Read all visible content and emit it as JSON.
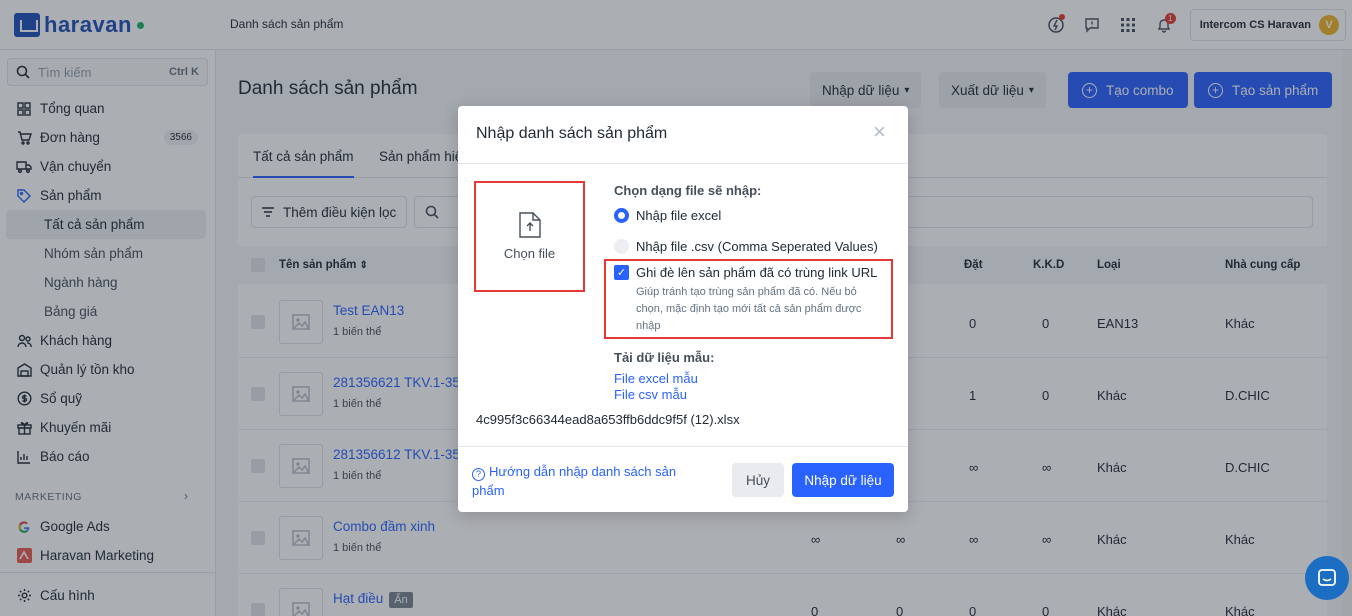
{
  "brand": {
    "name": "haravan"
  },
  "topbar": {
    "title": "Danh sách sản phẩm",
    "notification_count": "1",
    "account_name": "Intercom CS Haravan",
    "avatar_initial": "V"
  },
  "sidebar": {
    "search_placeholder": "Tìm kiếm",
    "search_shortcut": "Ctrl K",
    "items": [
      {
        "label": "Tổng quan",
        "icon": "grid-icon"
      },
      {
        "label": "Đơn hàng",
        "icon": "cart-icon",
        "count": "3566"
      },
      {
        "label": "Vận chuyển",
        "icon": "truck-icon"
      },
      {
        "label": "Sản phẩm",
        "icon": "tag-icon"
      }
    ],
    "sub_items": [
      {
        "label": "Tất cả sản phẩm",
        "active": true
      },
      {
        "label": "Nhóm sản phẩm"
      },
      {
        "label": "Ngành hàng"
      },
      {
        "label": "Bảng giá"
      }
    ],
    "items2": [
      {
        "label": "Khách hàng",
        "icon": "users-icon"
      },
      {
        "label": "Quản lý tồn kho",
        "icon": "inventory-icon"
      },
      {
        "label": "Sổ quỹ",
        "icon": "dollar-icon"
      },
      {
        "label": "Khuyến mãi",
        "icon": "gift-icon"
      },
      {
        "label": "Báo cáo",
        "icon": "chart-icon"
      }
    ],
    "marketing_label": "MARKETING",
    "marketing_items": [
      {
        "label": "Google Ads",
        "icon": "google-icon"
      },
      {
        "label": "Haravan Marketing",
        "icon": "haravan-marketing-icon"
      }
    ],
    "settings_label": "Cấu hình"
  },
  "main": {
    "title": "Danh sách sản phẩm",
    "import_label": "Nhập dữ liệu",
    "export_label": "Xuất dữ liệu",
    "create_combo_label": "Tạo combo",
    "create_product_label": "Tạo sản phẩm",
    "tabs": [
      "Tất cả sản phẩm",
      "Sản phẩm hiể"
    ],
    "filter_label": "Thêm điều kiện lọc",
    "columns": {
      "name": "Tên sản phẩm",
      "ordered": "Đặt",
      "kkd": "K.K.D",
      "type": "Loại",
      "supplier": "Nhà cung cấp"
    },
    "rows": [
      {
        "name": "Test EAN13",
        "variants": "1 biến thể",
        "c1": "",
        "c2": "",
        "ordered": "0",
        "kkd": "0",
        "type": "EAN13",
        "supplier": "Khác"
      },
      {
        "name": "281356621 TKV.1-350",
        "variants": "1 biến thể",
        "c1": "",
        "c2": "",
        "ordered": "1",
        "kkd": "0",
        "type": "Khác",
        "supplier": "D.CHIC"
      },
      {
        "name": "281356612 TKV.1-350",
        "variants": "1 biến thể",
        "c1": "",
        "c2": "",
        "ordered": "∞",
        "kkd": "∞",
        "type": "Khác",
        "supplier": "D.CHIC"
      },
      {
        "name": "Combo đầm xinh",
        "variants": "1 biến thể",
        "c1": "∞",
        "c2": "∞",
        "ordered": "∞",
        "kkd": "∞",
        "type": "Khác",
        "supplier": "Khác"
      },
      {
        "name": "Hạt điều",
        "variants": "",
        "tag": "Ẩn",
        "c1": "0",
        "c2": "0",
        "ordered": "0",
        "kkd": "0",
        "type": "Khác",
        "supplier": "Khác"
      }
    ]
  },
  "modal": {
    "title": "Nhập danh sách sản phẩm",
    "choose_file": "Chọn file",
    "file_type_title": "Chọn dạng file sẽ nhập:",
    "option_excel": "Nhập file excel",
    "option_csv": "Nhập file .csv (Comma Seperated Values)",
    "overwrite_label": "Ghi đè lên sản phẩm đã có trùng link URL",
    "overwrite_help": "Giúp tránh tạo trùng sản phẩm đã có. Nếu bỏ chọn, mặc định tạo mới tất cả sản phẩm được nhập",
    "sample_title": "Tải dữ liệu mẫu:",
    "sample_excel": "File excel mẫu",
    "sample_csv": "File csv mẫu",
    "filename": "4c995f3c66344ead8a653ffb6ddc9f5f (12).xlsx",
    "help_link": "Hướng dẫn nhập danh sách sản phẩm",
    "cancel": "Hủy",
    "submit": "Nhập dữ liệu"
  },
  "colors": {
    "primary": "#2962ff",
    "highlight": "#e53935",
    "brand": "#1d4fb8"
  }
}
